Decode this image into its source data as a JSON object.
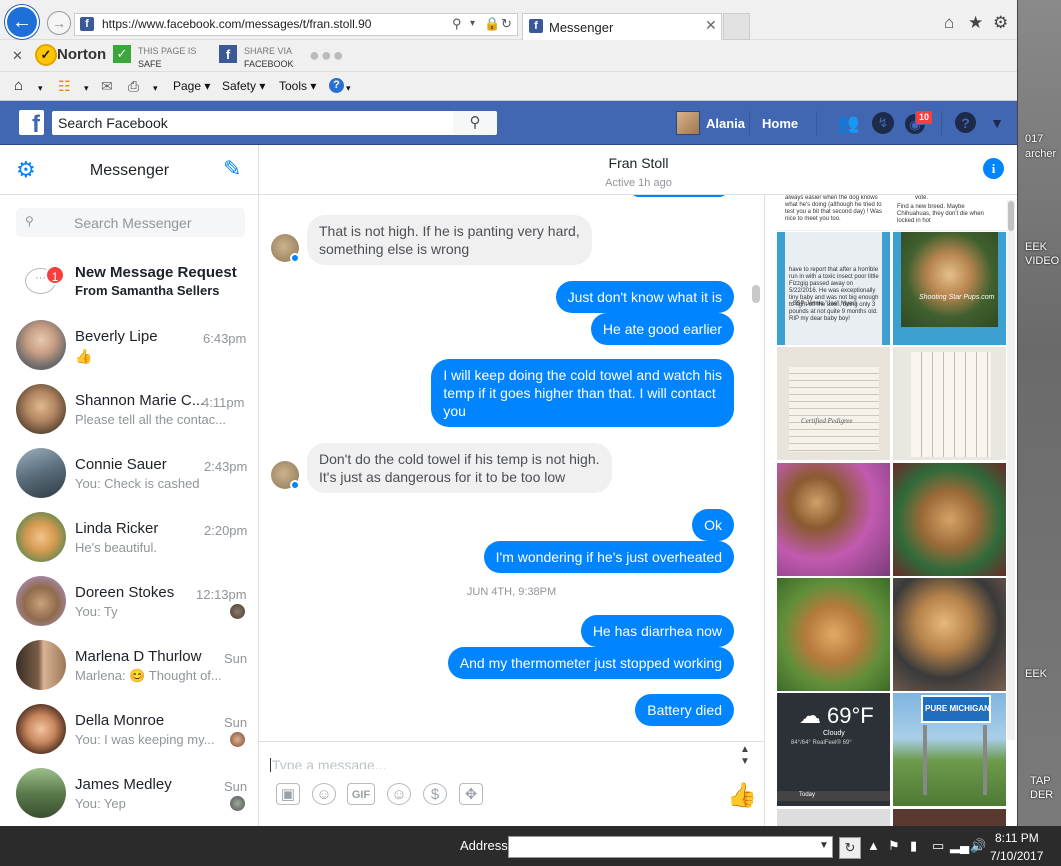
{
  "desktop": {
    "labels": [
      "017",
      "archer",
      "EEK",
      "VIDEO",
      "EEK",
      "TAP",
      "DER"
    ]
  },
  "browser": {
    "url": "https://www.facebook.com/messages/t/fran.stoll.90",
    "tab_title": "Messenger",
    "norton_label": "Norton",
    "safe_line1": "THIS PAGE IS",
    "safe_line2": "SAFE",
    "share_line1": "SHARE VIA",
    "share_line2": "FACEBOOK",
    "cmd_page": "Page",
    "cmd_safety": "Safety",
    "cmd_tools": "Tools"
  },
  "facebook": {
    "search_placeholder": "Search Facebook",
    "user_name": "Alania",
    "home_label": "Home",
    "notification_count": "10"
  },
  "messenger": {
    "title": "Messenger",
    "search_placeholder": "Search Messenger",
    "request": {
      "badge": "1",
      "title": "New Message Request",
      "from": "From Samantha Sellers"
    },
    "conversations": [
      {
        "name": "Beverly Lipe",
        "snippet": "",
        "time": "6:43pm"
      },
      {
        "name": "Shannon Marie C...",
        "snippet": "Please tell all the contac...",
        "time": "4:11pm"
      },
      {
        "name": "Connie Sauer",
        "snippet": "You: Check is cashed",
        "time": "2:43pm"
      },
      {
        "name": "Linda Ricker",
        "snippet": "He's beautiful.",
        "time": "2:20pm"
      },
      {
        "name": "Doreen Stokes",
        "snippet": "You: Ty",
        "time": "12:13pm"
      },
      {
        "name": "Marlena D Thurlow",
        "snippet": "Marlena: 😊 Thought of...",
        "time": "Sun"
      },
      {
        "name": "Della Monroe",
        "snippet": "You: I was keeping my...",
        "time": "Sun"
      },
      {
        "name": "James Medley",
        "snippet": "You: Yep",
        "time": "Sun"
      }
    ]
  },
  "thread": {
    "contact_name": "Fran Stoll",
    "status": "Active 1h ago",
    "date_separator": "JUN 4TH, 9:38PM",
    "messages": [
      {
        "dir": "in",
        "lines": [
          "That is not high.   If he is panting very hard,",
          "something else is wrong"
        ]
      },
      {
        "dir": "out",
        "lines": [
          "Just don't know what it is"
        ]
      },
      {
        "dir": "out",
        "lines": [
          "He ate good earlier"
        ]
      },
      {
        "dir": "out",
        "lines": [
          "I will keep doing the cold towel and watch his",
          "temp if it goes higher than that. I will contact",
          "you"
        ]
      },
      {
        "dir": "in",
        "lines": [
          "Don't do the cold towel if his temp is not high.",
          "It's just as dangerous for it to be too low"
        ]
      },
      {
        "dir": "out",
        "lines": [
          "Ok"
        ]
      },
      {
        "dir": "out",
        "lines": [
          "I'm wondering if he's just overheated"
        ]
      },
      {
        "dir": "out",
        "lines": [
          "He has diarrhea now"
        ]
      },
      {
        "dir": "out",
        "lines": [
          "And my thermometer just stopped working"
        ]
      },
      {
        "dir": "out",
        "lines": [
          "Battery died"
        ]
      }
    ],
    "composer_placeholder": "Type a message..."
  },
  "media": {
    "weather_temp": "69°F",
    "weather_cond": "Cloudy",
    "weather_detail": "84°/64° RealFeel® 69°",
    "weather_today": "Today",
    "sign_text": "PURE MICHIGAN",
    "doc_text_1": "always easier when the dog knows what he's doing (although he tried to test you a bit that second day) ! Was nice to meet you too.",
    "doc_text_2": "vote.",
    "doc_text_3": "Find a new breed. Maybe Chihuahuas, they don't die when locked in hot",
    "doc_text_4": "have to report that after a horrible run in with a toxic insect poor little Fizzgig passed away on 5/22/2016. He was exceptionally tiny baby and was not big enough to fight off the toxin, being only 3 pounds at not quite 9 months old. RIP my dear baby boy!",
    "doc_text_5": "~SSP Jennie \"Jae\" Myers",
    "watermark": "Shooting Star Pups.com",
    "pedigree_text": "Certified Pedigree"
  },
  "taskbar": {
    "address_label": "Address",
    "time": "8:11 PM",
    "date": "7/10/2017"
  }
}
